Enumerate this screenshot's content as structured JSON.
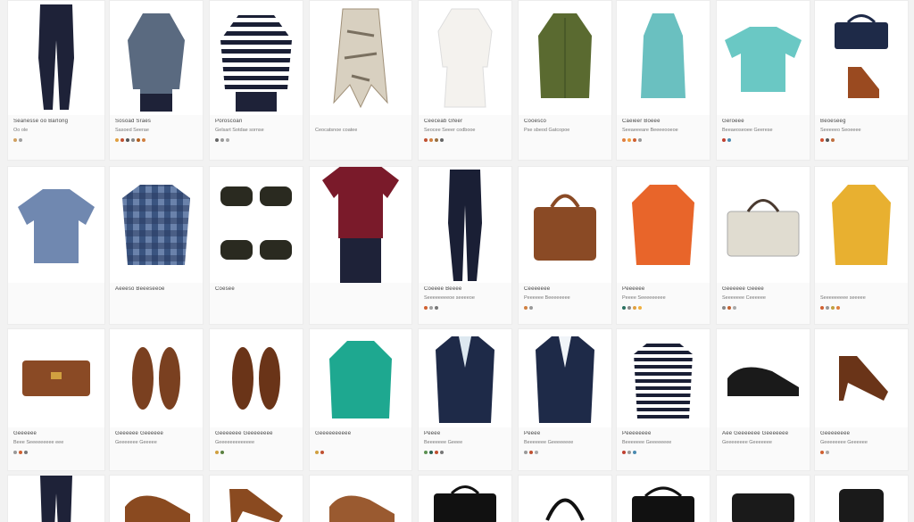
{
  "products": [
    {
      "row": 0,
      "col": 0,
      "item": "dark-trousers",
      "title": "Seanesse oo Barlong",
      "subtitle": "Oo ole",
      "swatches": [
        "#d0a060",
        "#a0a0a0"
      ]
    },
    {
      "row": 0,
      "col": 1,
      "item": "patterned-blouse",
      "title": "Sosoad Sraes",
      "subtitle": "Sasoed Seerae",
      "swatches": [
        "#e0a040",
        "#c05030",
        "#555",
        "#888",
        "#b06020",
        "#d08040"
      ]
    },
    {
      "row": 0,
      "col": 2,
      "item": "striped-sweater",
      "title": "Poroscoan",
      "subtitle": "Gelsart Sotdae sornse",
      "swatches": [
        "#666",
        "#999",
        "#aaa"
      ]
    },
    {
      "row": 0,
      "col": 3,
      "item": "printed-scarf",
      "title": "",
      "subtitle": "Ceocatsnoe coatee",
      "swatches": []
    },
    {
      "row": 0,
      "col": 4,
      "item": "white-tunic",
      "title": "Ceeceab Gfeer",
      "subtitle": "Seocee Seeer codbooe",
      "swatches": [
        "#c05030",
        "#d08040",
        "#9a7040",
        "#666"
      ]
    },
    {
      "row": 0,
      "col": 5,
      "item": "olive-jacket",
      "title": "Cooesco",
      "subtitle": "Pse sbeod Gatcopoe",
      "swatches": []
    },
    {
      "row": 0,
      "col": 6,
      "item": "teal-sleeveless-top",
      "title": "Caeieer Boeee",
      "subtitle": "Seeaeeeare Beeeeooeoe",
      "swatches": [
        "#e08040",
        "#f0a040",
        "#d06030",
        "#999"
      ]
    },
    {
      "row": 0,
      "col": 7,
      "item": "teal-polo",
      "title": "Geroeee",
      "subtitle": "Beeaeoseoee Geerese",
      "swatches": [
        "#c04030",
        "#4a8ab0"
      ]
    },
    {
      "row": 0,
      "col": 8,
      "item": "bag-and-shoes",
      "title": "Beoeseeg",
      "subtitle": "Seeeeeo Seoeeee",
      "swatches": [
        "#d05030",
        "#555",
        "#c07040"
      ]
    },
    {
      "row": 1,
      "col": 0,
      "item": "printed-shirt",
      "title": "",
      "subtitle": "",
      "swatches": []
    },
    {
      "row": 1,
      "col": 1,
      "item": "plaid-shirt",
      "title": "Aeeeso Beeeseeoe",
      "subtitle": "",
      "swatches": []
    },
    {
      "row": 1,
      "col": 2,
      "item": "sunglasses",
      "title": "Coesee",
      "subtitle": "",
      "swatches": []
    },
    {
      "row": 1,
      "col": 3,
      "item": "burgundy-dress",
      "title": "",
      "subtitle": "",
      "swatches": []
    },
    {
      "row": 1,
      "col": 4,
      "item": "navy-trousers",
      "title": "Coeeee Beeee",
      "subtitle": "Seeeeeeeeoe seeeeoe",
      "swatches": [
        "#d06030",
        "#a0a0a0",
        "#777"
      ]
    },
    {
      "row": 1,
      "col": 5,
      "item": "leather-tote",
      "title": "Ceeeeeee",
      "subtitle": "Peeeeee Beeeeeeee",
      "swatches": [
        "#d08040",
        "#999"
      ]
    },
    {
      "row": 1,
      "col": 6,
      "item": "orange-sweater",
      "title": "Peeeeee",
      "subtitle": "Peeee Seeeeeeeee",
      "swatches": [
        "#2a7060",
        "#888",
        "#e0a040",
        "#f0b040"
      ]
    },
    {
      "row": 1,
      "col": 7,
      "item": "canvas-handbag",
      "title": "Geeeeee Geeee",
      "subtitle": "Seeeeeee Ceeeeee",
      "swatches": [
        "#888",
        "#c06030",
        "#aaa"
      ]
    },
    {
      "row": 1,
      "col": 8,
      "item": "mustard-sweater",
      "title": "",
      "subtitle": "Seeeeeeeee seeeee",
      "swatches": [
        "#d06030",
        "#999",
        "#c0a040",
        "#e08040"
      ]
    },
    {
      "row": 2,
      "col": 0,
      "item": "leather-wallet",
      "title": "Geeeeee",
      "subtitle": "Beee Seeeeeeeee eee",
      "swatches": [
        "#999",
        "#d06030",
        "#777"
      ]
    },
    {
      "row": 2,
      "col": 1,
      "item": "brown-oxfords",
      "title": "Geeeeee Geeeeee",
      "subtitle": "Geeeeeee Geeeee",
      "swatches": []
    },
    {
      "row": 2,
      "col": 2,
      "item": "brown-shoes",
      "title": "Geeeeeee Geeeeeeee",
      "subtitle": "Geeeeeeeeeeeee",
      "swatches": [
        "#d0a040",
        "#5a8040"
      ]
    },
    {
      "row": 2,
      "col": 3,
      "item": "green-blouse",
      "title": "Geeeeeeeeee",
      "subtitle": "",
      "swatches": [
        "#d0a040",
        "#c05030"
      ]
    },
    {
      "row": 2,
      "col": 4,
      "item": "navy-blazer",
      "title": "Peeee",
      "subtitle": "Beeeeeee Geeee",
      "swatches": [
        "#5a9050",
        "#2a6050",
        "#c05030",
        "#777"
      ]
    },
    {
      "row": 2,
      "col": 5,
      "item": "navy-blazer-2",
      "title": "Peeee",
      "subtitle": "Beeeeeee Geeeeeeee",
      "swatches": [
        "#999",
        "#c05030",
        "#aaa"
      ]
    },
    {
      "row": 2,
      "col": 6,
      "item": "striped-top",
      "title": "Peeeeeeee",
      "subtitle": "Beeeeeee Geeeeeeee",
      "swatches": [
        "#c04030",
        "#999",
        "#4a8ab0"
      ]
    },
    {
      "row": 2,
      "col": 7,
      "item": "black-loafers",
      "title": "Aee Geeeeeee Geeeeeee",
      "subtitle": "Geeeeeeee Geeeeeee",
      "swatches": []
    },
    {
      "row": 2,
      "col": 8,
      "item": "brown-heels",
      "title": "Geeeeeeee",
      "subtitle": "Geeeeeeee Geeeeee",
      "swatches": [
        "#d06030",
        "#aaa"
      ]
    },
    {
      "row": 3,
      "col": 0,
      "item": "dark-trousers-2",
      "title": "",
      "subtitle": "",
      "swatches": []
    },
    {
      "row": 3,
      "col": 1,
      "item": "brown-loafer",
      "title": "",
      "subtitle": "",
      "swatches": []
    },
    {
      "row": 3,
      "col": 2,
      "item": "brown-heel",
      "title": "",
      "subtitle": "",
      "swatches": []
    },
    {
      "row": 3,
      "col": 3,
      "item": "brown-shoe",
      "title": "",
      "subtitle": "",
      "swatches": []
    },
    {
      "row": 3,
      "col": 4,
      "item": "black-bag",
      "title": "",
      "subtitle": "",
      "swatches": []
    },
    {
      "row": 3,
      "col": 5,
      "item": "strap-bag",
      "title": "",
      "subtitle": "",
      "swatches": []
    },
    {
      "row": 3,
      "col": 6,
      "item": "black-handbag",
      "title": "",
      "subtitle": "",
      "swatches": []
    },
    {
      "row": 3,
      "col": 7,
      "item": "black-clutch",
      "title": "",
      "subtitle": "",
      "swatches": []
    },
    {
      "row": 3,
      "col": 8,
      "item": "black-backpack",
      "title": "",
      "subtitle": "",
      "swatches": []
    }
  ]
}
